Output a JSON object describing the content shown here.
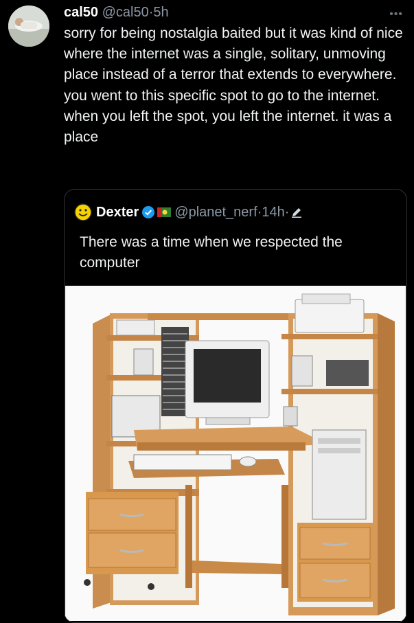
{
  "tweet": {
    "display_name": "cal50",
    "handle": "@cal50",
    "separator": "·",
    "time": "5h",
    "more_icon": "more-horizontal-icon",
    "text": "sorry for being nostalgia baited but it was kind of nice where the internet was a single, solitary, unmoving place instead of a terror that extends to everywhere. you went to this specific spot to go to the internet.  when you left the spot, you left the internet. it was a place"
  },
  "quote": {
    "display_name": "Dexter",
    "handle": "@planet_nerf",
    "separator": "·",
    "time": "14h",
    "separator2": "·",
    "text": "There was a time when we respected the computer",
    "icons": [
      "smiley-face-icon",
      "verified-badge-icon",
      "flag-icon",
      "pencil-icon"
    ],
    "image": "computer-desk-photo"
  },
  "colors": {
    "background": "#000000",
    "text": "#e7e9ea",
    "muted": "#8b98a5",
    "border": "#2f3336",
    "verified": "#1d9bf0"
  }
}
